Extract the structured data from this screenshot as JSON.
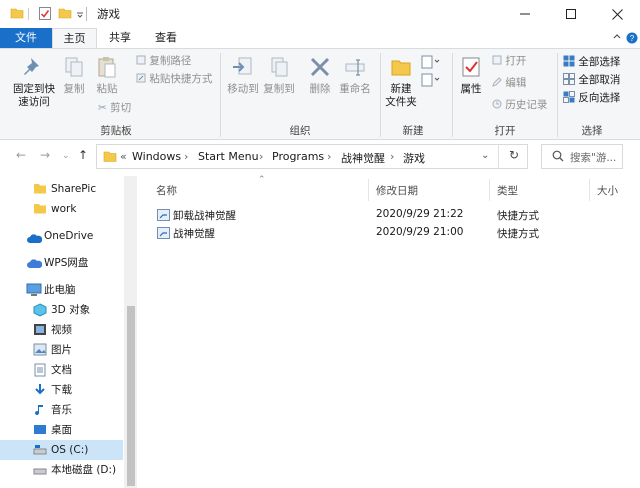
{
  "window": {
    "title": "游戏",
    "icons": {
      "folder": "folder-icon",
      "properties": "properties-icon",
      "new_folder": "new-folder-icon",
      "dropdown": "chevron-down-icon"
    }
  },
  "ribbon_tabs": {
    "file": "文件",
    "home": "主页",
    "share": "共享",
    "view": "查看"
  },
  "ribbon": {
    "clipboard": {
      "pin_line1": "固定到快",
      "pin_line2": "速访问",
      "copy": "复制",
      "paste": "粘贴",
      "copy_path": "复制路径",
      "paste_shortcut": "粘贴快捷方式",
      "cut": "剪切",
      "label": "剪贴板"
    },
    "organize": {
      "move_to": "移动到",
      "copy_to": "复制到",
      "delete": "删除",
      "rename": "重命名",
      "label": "组织"
    },
    "new": {
      "new_folder_line1": "新建",
      "new_folder_line2": "文件夹",
      "label": "新建"
    },
    "open": {
      "properties": "属性",
      "open": "打开",
      "edit": "编辑",
      "history": "历史记录",
      "label": "打开"
    },
    "select": {
      "select_all": "全部选择",
      "select_none": "全部取消",
      "invert": "反向选择",
      "label": "选择"
    }
  },
  "address": {
    "prefix": "«",
    "crumbs": [
      "Windows",
      "Start Menu",
      "Programs",
      "战神觉醒",
      "游戏"
    ],
    "search_placeholder": "搜索\"游..."
  },
  "nav": {
    "items": [
      {
        "label": "SharePic",
        "icon": "folder-icon"
      },
      {
        "label": "work",
        "icon": "folder-icon"
      },
      {
        "label": "OneDrive",
        "icon": "cloud-icon"
      },
      {
        "label": "WPS网盘",
        "icon": "wps-cloud-icon"
      },
      {
        "label": "此电脑",
        "icon": "computer-icon"
      },
      {
        "label": "3D 对象",
        "icon": "cube-icon"
      },
      {
        "label": "视频",
        "icon": "video-icon"
      },
      {
        "label": "图片",
        "icon": "picture-icon"
      },
      {
        "label": "文档",
        "icon": "document-icon"
      },
      {
        "label": "下载",
        "icon": "download-icon"
      },
      {
        "label": "音乐",
        "icon": "music-icon"
      },
      {
        "label": "桌面",
        "icon": "desktop-icon"
      },
      {
        "label": "OS (C:)",
        "icon": "drive-icon"
      },
      {
        "label": "本地磁盘 (D:)",
        "icon": "drive-icon"
      }
    ],
    "selected_index": 12
  },
  "list": {
    "columns": {
      "name": "名称",
      "modified": "修改日期",
      "type": "类型",
      "size": "大小"
    },
    "files": [
      {
        "name": "卸载战神觉醒",
        "modified": "2020/9/29 21:22",
        "type": "快捷方式"
      },
      {
        "name": "战神觉醒",
        "modified": "2020/9/29 21:00",
        "type": "快捷方式"
      }
    ]
  },
  "colors": {
    "accent": "#1a6fc9",
    "folder": "#f4c84a",
    "selection": "#cce4f7"
  }
}
